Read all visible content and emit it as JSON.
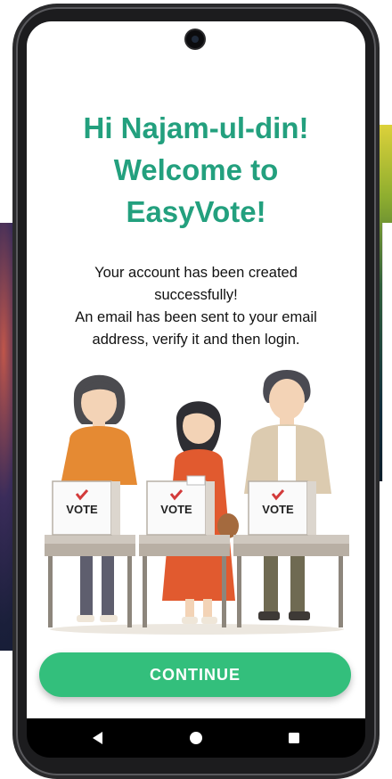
{
  "greeting": {
    "line1": "Hi Najam-ul-din!",
    "line2": "Welcome to",
    "line3": "EasyVote!"
  },
  "message": {
    "line1": "Your account has been created",
    "line2": "successfully!",
    "line3": "An email has been sent to your email",
    "line4": "address, verify it and then login."
  },
  "illustration": {
    "ballot_label": "VOTE"
  },
  "actions": {
    "continue_label": "CONTINUE"
  },
  "colors": {
    "title": "#23a07e",
    "button": "#33bf7c"
  },
  "navigation": {
    "back_icon": "back-triangle",
    "home_icon": "home-circle",
    "recents_icon": "recents-square"
  }
}
